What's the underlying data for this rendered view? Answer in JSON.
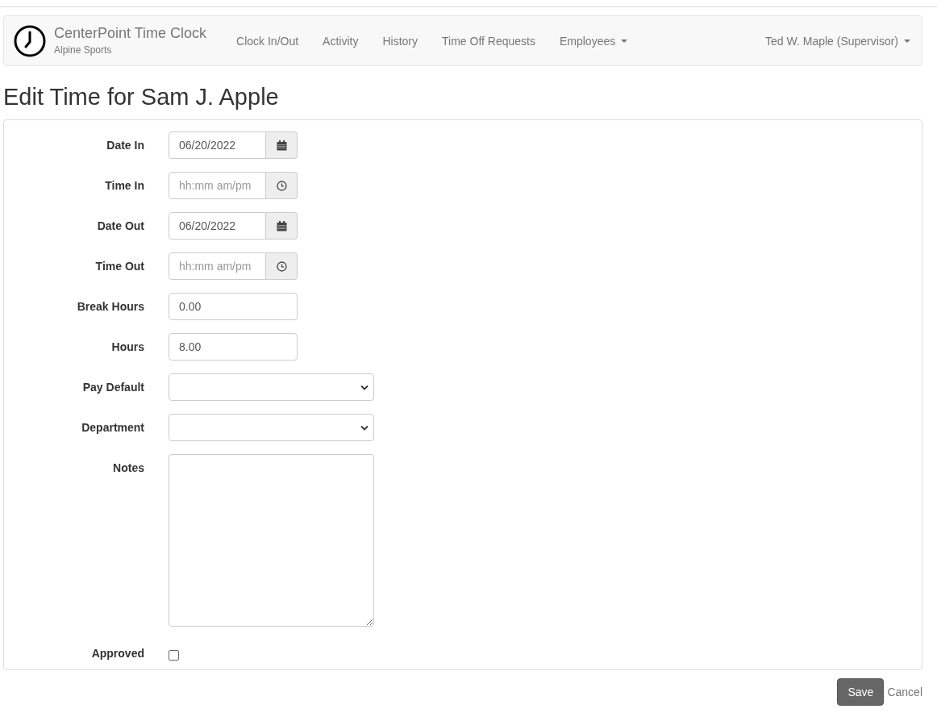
{
  "navbar": {
    "brand": "CenterPoint Time Clock",
    "company": "Alpine Sports",
    "links": [
      {
        "label": "Clock In/Out",
        "dropdown": false
      },
      {
        "label": "Activity",
        "dropdown": false
      },
      {
        "label": "History",
        "dropdown": false
      },
      {
        "label": "Time Off Requests",
        "dropdown": false
      },
      {
        "label": "Employees",
        "dropdown": true
      }
    ],
    "user": {
      "label": "Ted W. Maple (Supervisor)",
      "dropdown": true
    }
  },
  "title": "Edit Time for Sam J. Apple",
  "fields": [
    {
      "kind": "date",
      "label": "Date In",
      "value": "06/20/2022"
    },
    {
      "kind": "time",
      "label": "Time In",
      "placeholder": "hh:mm am/pm"
    },
    {
      "kind": "date",
      "label": "Date Out",
      "value": "06/20/2022"
    },
    {
      "kind": "time",
      "label": "Time Out",
      "placeholder": "hh:mm am/pm"
    },
    {
      "kind": "text",
      "label": "Break Hours",
      "value": "0.00"
    },
    {
      "kind": "text",
      "label": "Hours",
      "value": "8.00"
    },
    {
      "kind": "select",
      "label": "Pay Default"
    },
    {
      "kind": "select",
      "label": "Department"
    },
    {
      "kind": "textarea",
      "label": "Notes"
    },
    {
      "kind": "checkbox",
      "label": "Approved",
      "checked": false
    }
  ],
  "buttons": {
    "save": "Save",
    "cancel": "Cancel"
  }
}
